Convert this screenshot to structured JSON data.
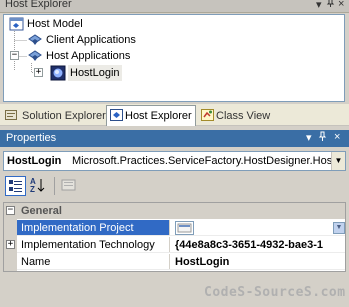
{
  "host_explorer": {
    "title": "Host Explorer",
    "controls": {
      "pin": "ᵖ",
      "close": "×",
      "dropdown": "▾"
    },
    "tree": [
      {
        "label": "Host Model",
        "icon": "host-model-icon",
        "expander": ""
      },
      {
        "label": "Client Applications",
        "icon": "client-applications-icon",
        "expander": ""
      },
      {
        "label": "Host Applications",
        "icon": "host-applications-icon",
        "expander": "−"
      },
      {
        "label": "HostLogin",
        "icon": "host-login-icon",
        "expander": "+"
      }
    ]
  },
  "tabs": [
    {
      "label": "Solution Explorer",
      "icon": "solution-explorer-icon",
      "active": false
    },
    {
      "label": "Host Explorer",
      "icon": "host-explorer-icon",
      "active": true
    },
    {
      "label": "Class View",
      "icon": "class-view-icon",
      "active": false
    }
  ],
  "properties": {
    "title": "Properties",
    "selector": {
      "name": "HostLogin",
      "type": "Microsoft.Practices.ServiceFactory.HostDesigner.HostA"
    },
    "grid": {
      "category": "General",
      "category_expander": "−",
      "rows": [
        {
          "name": "Implementation Project",
          "value": "",
          "selected": true
        },
        {
          "name": "Implementation Technology",
          "value": "{44e8a8c3-3651-4932-bae3-1",
          "expander": "+"
        },
        {
          "name": "Name",
          "value": "HostLogin"
        }
      ]
    }
  },
  "watermark": "CodeS-SourceS.com",
  "colors": {
    "title_active": "#3a6ea5",
    "selection": "#316ac5",
    "chrome": "#d4d0c8"
  }
}
